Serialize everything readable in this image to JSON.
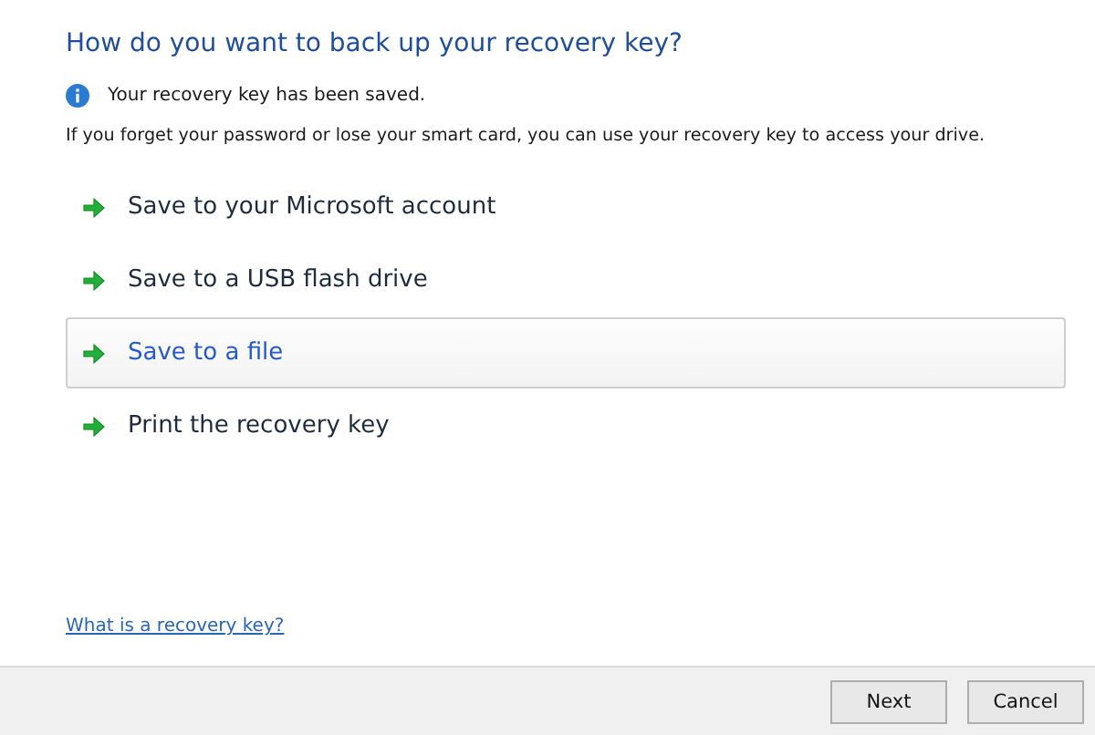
{
  "heading": "How do you want to back up your recovery key?",
  "notice": "Your recovery key has been saved.",
  "description": "If you forget your password or lose your smart card, you can use your recovery key to access your drive.",
  "options": [
    {
      "label": "Save to your Microsoft account",
      "selected": false
    },
    {
      "label": "Save to a USB flash drive",
      "selected": false
    },
    {
      "label": "Save to a file",
      "selected": true
    },
    {
      "label": "Print the recovery key",
      "selected": false
    }
  ],
  "help_link": "What is a recovery key?",
  "buttons": [
    "Next",
    "Cancel"
  ]
}
